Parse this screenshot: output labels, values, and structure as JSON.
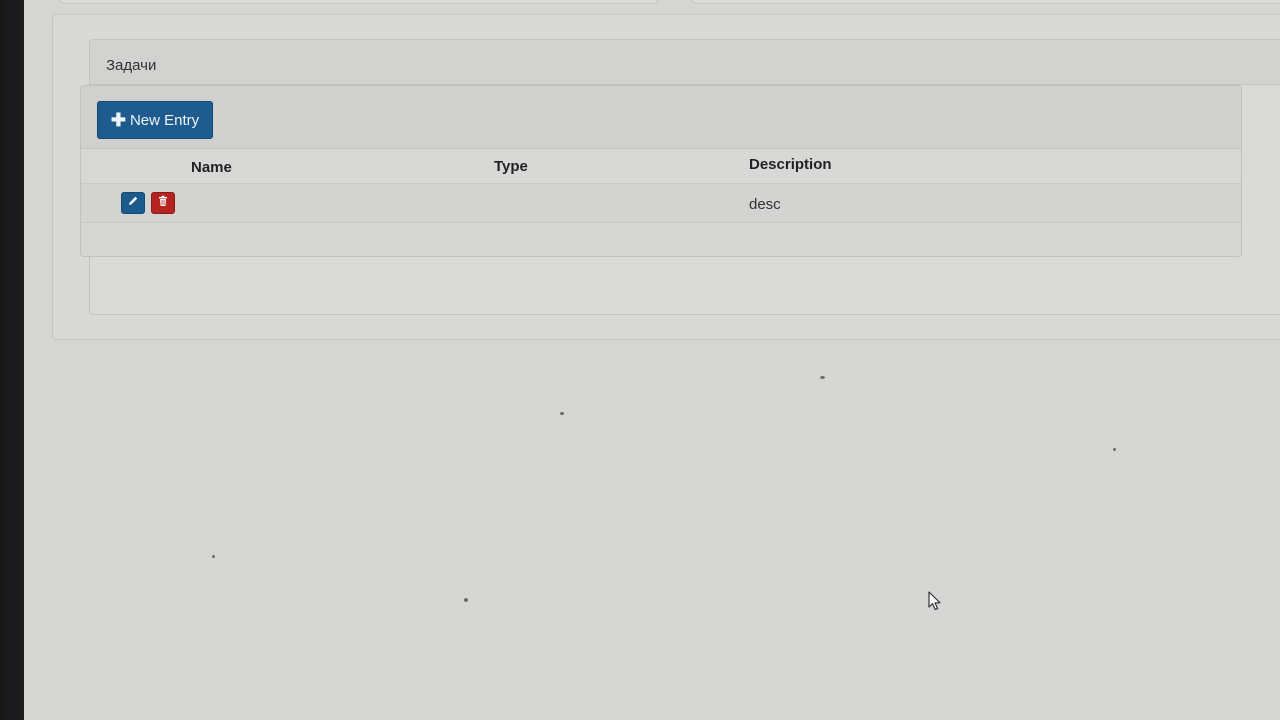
{
  "panel": {
    "title": "Задачи"
  },
  "toolbar": {
    "new_entry_label": "New Entry"
  },
  "table": {
    "columns": [
      "Name",
      "Type",
      "Description"
    ],
    "rows": [
      {
        "name": "",
        "type": "",
        "description": "desc"
      }
    ]
  },
  "icons": {
    "new_entry": "plus-icon",
    "edit": "pencil-icon",
    "delete": "trash-icon",
    "cursor": "mouse-pointer-icon"
  },
  "colors": {
    "primary_button": "#1e5c8f",
    "danger_button": "#b52420",
    "panel_background": "#d9d9d7"
  }
}
